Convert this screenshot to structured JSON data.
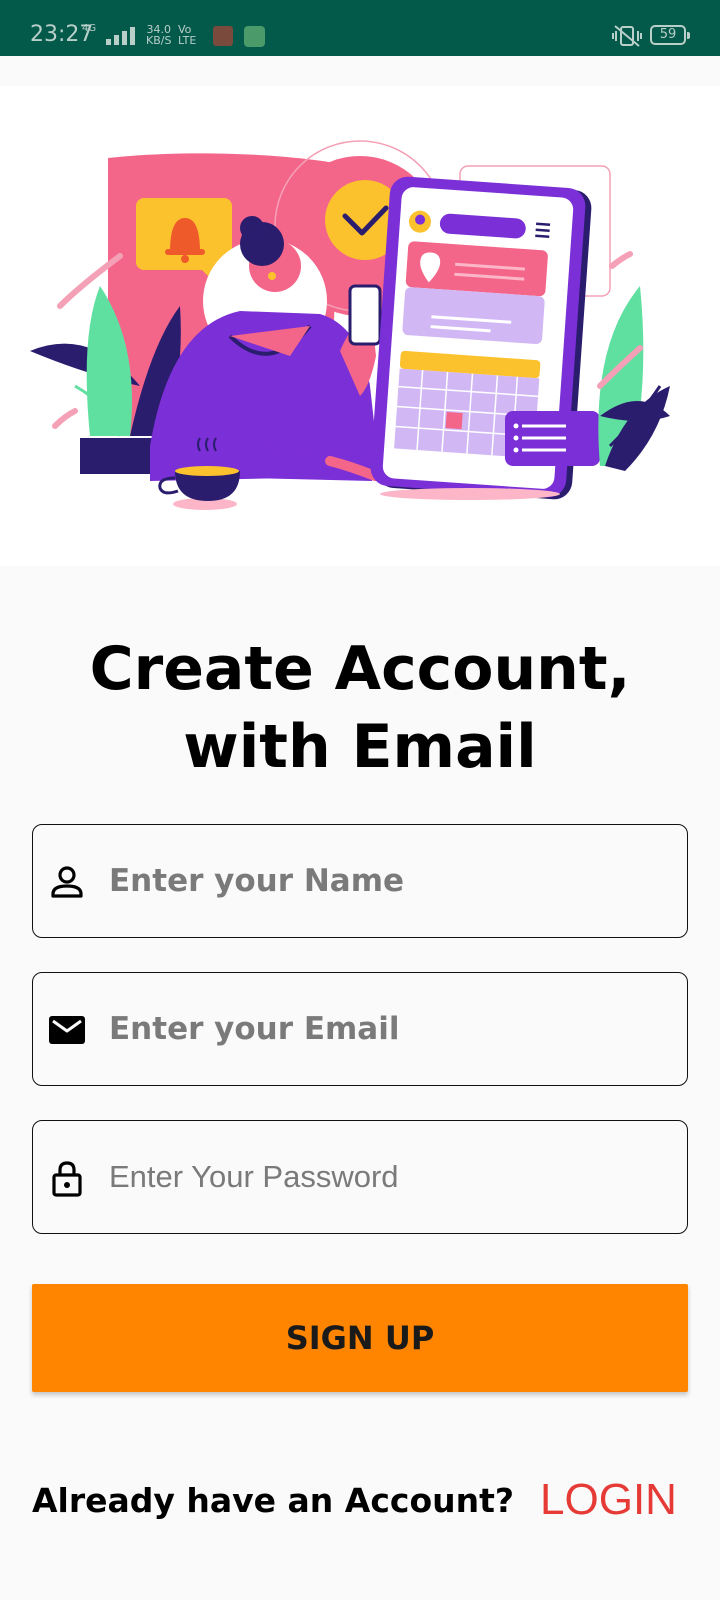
{
  "status_bar": {
    "time": "23:27",
    "network": "4G",
    "speed_value": "34.0",
    "speed_unit": "KB/S",
    "volte_top": "Vo",
    "volte_bottom": "LTE",
    "battery": "59",
    "background_color": "#03594a"
  },
  "page": {
    "title_line1": "Create Account,",
    "title_line2": "with Email"
  },
  "form": {
    "name": {
      "placeholder": "Enter your Name",
      "value": "",
      "icon": "person-icon"
    },
    "email": {
      "placeholder": "Enter your Email",
      "value": "",
      "icon": "mail-icon"
    },
    "password": {
      "placeholder": "Enter Your Password",
      "value": "",
      "icon": "lock-icon"
    },
    "signup_label": "SIGN UP"
  },
  "footer": {
    "question": "Already have an Account?",
    "login_label": "LOGIN"
  },
  "colors": {
    "accent_orange": "#ff8500",
    "login_red": "#e53a35",
    "illustration_purple": "#7b2fd6",
    "illustration_pink": "#f4658a"
  }
}
